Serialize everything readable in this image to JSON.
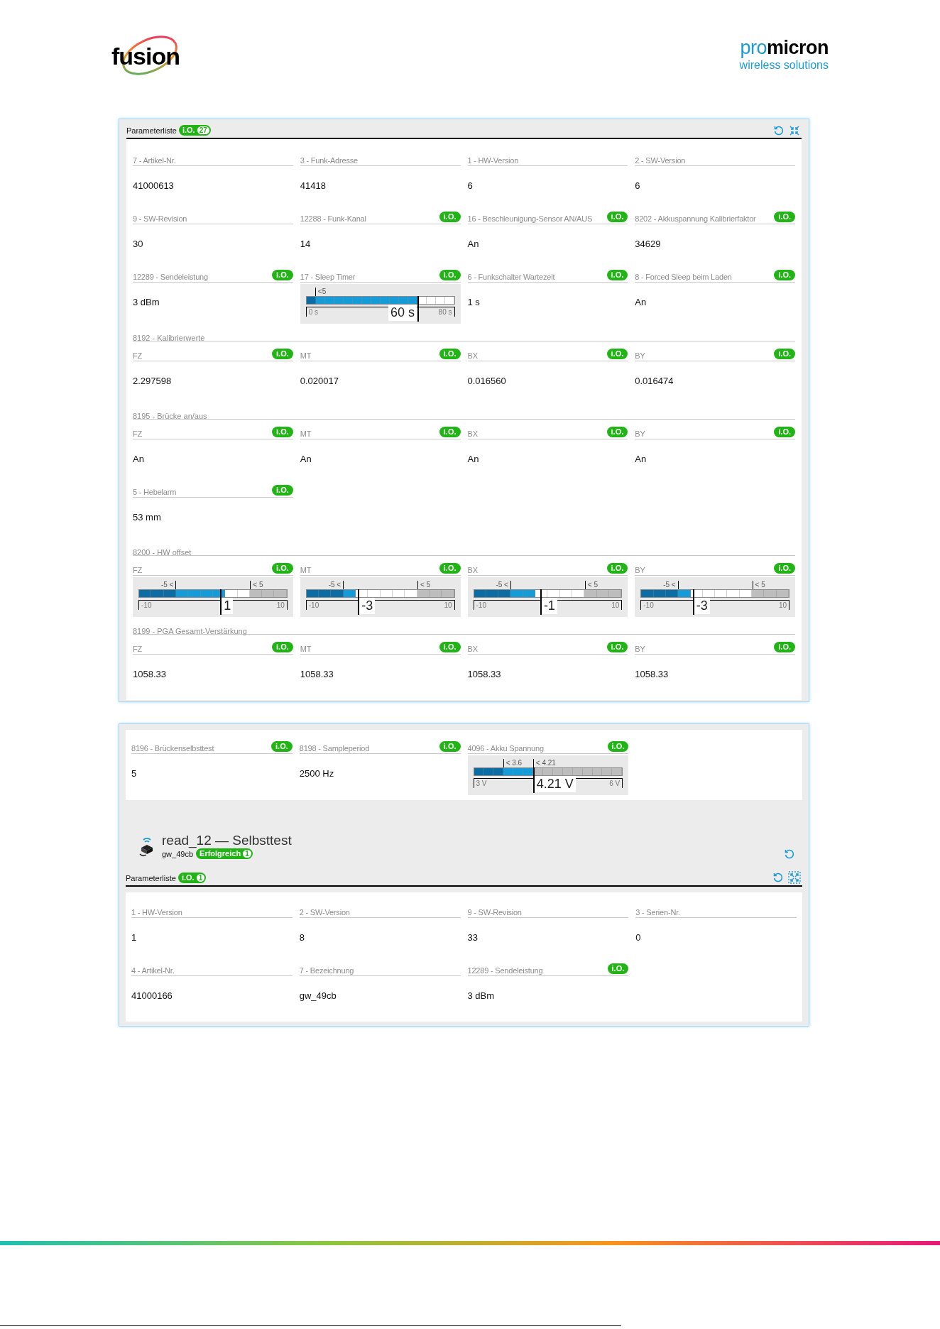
{
  "header": {
    "left_logo": "fusion",
    "right_logo": {
      "part_1": "pro",
      "part_2": "micron"
    },
    "tagline": "wireless solutions"
  },
  "panel_1": {
    "title": "Parameterliste",
    "badge": {
      "text": "i.O.",
      "count": "27"
    },
    "items": [
      {
        "kind": "field",
        "label": "7 - Artikel-Nr.",
        "value": "41000613"
      },
      {
        "kind": "field",
        "label": "3 - Funk-Adresse",
        "value": "41418"
      },
      {
        "kind": "field",
        "label": "1 - HW-Version",
        "value": "6"
      },
      {
        "kind": "field",
        "label": "2 - SW-Version",
        "value": "6"
      },
      {
        "kind": "field",
        "label": "9 - SW-Revision",
        "value": "30"
      },
      {
        "kind": "field",
        "label": "12288 - Funk-Kanal",
        "badge": "i.O.",
        "value": "14"
      },
      {
        "kind": "field",
        "label": "16 - Beschleunigung-Sensor AN/AUS",
        "badge": "i.O.",
        "value": "An"
      },
      {
        "kind": "field",
        "label": "8202 - Akkuspannung Kalibrierfaktor",
        "badge": "i.O.",
        "value": "34629"
      },
      {
        "kind": "field",
        "label": "12289 - Sendeleistung",
        "badge": "i.O.",
        "value": "3 dBm"
      },
      {
        "kind": "gauge",
        "label": "17 - Sleep Timer",
        "badge": "i.O.",
        "min": "0 s",
        "max": "80 s",
        "value": "60 s",
        "level": 0.75,
        "cells": [
          {
            "kind": "low"
          },
          {
            "kind": "mid",
            "mark": {
              "text": "<5",
              "before": false
            }
          },
          {
            "kind": "mid"
          },
          {
            "kind": "mid"
          },
          {
            "kind": "mid"
          },
          {
            "kind": "mid"
          },
          {
            "kind": "mid"
          },
          {
            "kind": "mid"
          },
          {
            "kind": "mid"
          },
          {
            "kind": "mid"
          },
          {
            "kind": "mid"
          },
          {
            "kind": "mid"
          },
          {
            "kind": "mid"
          },
          {
            "kind": "mid"
          },
          {
            "kind": "mid"
          },
          {
            "kind": "mid"
          }
        ]
      },
      {
        "kind": "field",
        "label": "6 - Funkschalter Wartezeit",
        "badge": "i.O.",
        "value": "1 s"
      },
      {
        "kind": "field",
        "label": "8 - Forced Sleep beim Laden",
        "badge": "i.O.",
        "value": "An"
      },
      {
        "kind": "section",
        "label": "8192 - Kalibrierwerte"
      },
      {
        "kind": "field",
        "label": "FZ",
        "badge": "i.O.",
        "value": "2.297598"
      },
      {
        "kind": "field",
        "label": "MT",
        "badge": "i.O.",
        "value": "0.020017"
      },
      {
        "kind": "field",
        "label": "BX",
        "badge": "i.O.",
        "value": "0.016560"
      },
      {
        "kind": "field",
        "label": "BY",
        "badge": "i.O.",
        "value": "0.016474"
      },
      {
        "kind": "section",
        "label": "8195 - Brücke an/aus"
      },
      {
        "kind": "field",
        "label": "FZ",
        "badge": "i.O.",
        "value": "An"
      },
      {
        "kind": "field",
        "label": "MT",
        "badge": "i.O.",
        "value": "An"
      },
      {
        "kind": "field",
        "label": "BX",
        "badge": "i.O.",
        "value": "An"
      },
      {
        "kind": "field",
        "label": "BY",
        "badge": "i.O.",
        "value": "An"
      },
      {
        "kind": "field",
        "label": "5 - Hebelarm",
        "badge": "i.O.",
        "value": "53 mm"
      },
      {
        "kind": "section",
        "label": "8200 - HW offset"
      },
      {
        "kind": "gauge",
        "label": "FZ",
        "badge": "i.O.",
        "min": "-10",
        "max": "10",
        "value": "1",
        "level": 0.55,
        "cells": [
          {
            "kind": "low"
          },
          {
            "kind": "low"
          },
          {
            "kind": "low"
          },
          {
            "kind": "mid",
            "mark": {
              "text": "-5 <",
              "before": true
            }
          },
          {
            "kind": "mid"
          },
          {
            "kind": "mid"
          },
          {
            "kind": "mid"
          },
          {
            "kind": "mid"
          },
          {
            "kind": "mid"
          },
          {
            "kind": "high",
            "mark": {
              "text": "< 5",
              "before": false
            }
          },
          {
            "kind": "high"
          },
          {
            "kind": "high"
          }
        ]
      },
      {
        "kind": "gauge",
        "label": "MT",
        "badge": "i.O.",
        "min": "-10",
        "max": "10",
        "value": "-3",
        "level": 0.35,
        "cells": [
          {
            "kind": "low"
          },
          {
            "kind": "low"
          },
          {
            "kind": "low"
          },
          {
            "kind": "mid",
            "mark": {
              "text": "-5 <",
              "before": true
            }
          },
          {
            "kind": "mid"
          },
          {
            "kind": "mid"
          },
          {
            "kind": "mid"
          },
          {
            "kind": "mid"
          },
          {
            "kind": "mid"
          },
          {
            "kind": "high",
            "mark": {
              "text": "< 5",
              "before": false
            }
          },
          {
            "kind": "high"
          },
          {
            "kind": "high"
          }
        ]
      },
      {
        "kind": "gauge",
        "label": "BX",
        "badge": "i.O.",
        "min": "-10",
        "max": "10",
        "value": "-1",
        "level": 0.45,
        "cells": [
          {
            "kind": "low"
          },
          {
            "kind": "low"
          },
          {
            "kind": "low"
          },
          {
            "kind": "mid",
            "mark": {
              "text": "-5 <",
              "before": true
            }
          },
          {
            "kind": "mid"
          },
          {
            "kind": "mid"
          },
          {
            "kind": "mid"
          },
          {
            "kind": "mid"
          },
          {
            "kind": "mid"
          },
          {
            "kind": "high",
            "mark": {
              "text": "< 5",
              "before": false
            }
          },
          {
            "kind": "high"
          },
          {
            "kind": "high"
          }
        ]
      },
      {
        "kind": "gauge",
        "label": "BY",
        "badge": "i.O.",
        "min": "-10",
        "max": "10",
        "value": "-3",
        "level": 0.35,
        "cells": [
          {
            "kind": "low"
          },
          {
            "kind": "low"
          },
          {
            "kind": "low"
          },
          {
            "kind": "mid",
            "mark": {
              "text": "-5 <",
              "before": true
            }
          },
          {
            "kind": "mid"
          },
          {
            "kind": "mid"
          },
          {
            "kind": "mid"
          },
          {
            "kind": "mid"
          },
          {
            "kind": "mid"
          },
          {
            "kind": "high",
            "mark": {
              "text": "< 5",
              "before": false
            }
          },
          {
            "kind": "high"
          },
          {
            "kind": "high"
          }
        ]
      },
      {
        "kind": "section",
        "label": "8199 - PGA Gesamt-Verstärkung"
      },
      {
        "kind": "field",
        "label": "FZ",
        "badge": "i.O.",
        "value": "1058.33"
      },
      {
        "kind": "field",
        "label": "MT",
        "badge": "i.O.",
        "value": "1058.33"
      },
      {
        "kind": "field",
        "label": "BX",
        "badge": "i.O.",
        "value": "1058.33"
      },
      {
        "kind": "field",
        "label": "BY",
        "badge": "i.O.",
        "value": "1058.33"
      }
    ]
  },
  "panel_2": {
    "items": [
      {
        "kind": "field",
        "label": "8196 - Brückenselbsttest",
        "badge": "i.O.",
        "value": "5"
      },
      {
        "kind": "field",
        "label": "8198 - Sampleperiod",
        "badge": "i.O.",
        "value": "2500 Hz"
      },
      {
        "kind": "gauge",
        "label": "4096 - Akku Spannung",
        "badge": "i.O.",
        "min": "3 V",
        "max": "6 V",
        "value": "4.21 V",
        "level": 0.4,
        "cells": [
          {
            "kind": "low"
          },
          {
            "kind": "low"
          },
          {
            "kind": "low"
          },
          {
            "kind": "mid",
            "mark": {
              "text": "< 3.6",
              "before": false
            }
          },
          {
            "kind": "mid"
          },
          {
            "kind": "mid"
          },
          {
            "kind": "high",
            "mark": {
              "text": "< 4.21",
              "before": false
            }
          },
          {
            "kind": "high"
          },
          {
            "kind": "high"
          },
          {
            "kind": "high"
          },
          {
            "kind": "high"
          },
          {
            "kind": "high"
          },
          {
            "kind": "high"
          },
          {
            "kind": "high"
          },
          {
            "kind": "high"
          }
        ]
      }
    ],
    "device": {
      "title": "read_12 — Selbsttest",
      "subtitle": "gw_49cb",
      "status": {
        "text": "Erfolgreich",
        "count": "1"
      }
    },
    "list": {
      "title": "Parameterliste",
      "badge": {
        "text": "i.O.",
        "count": "1"
      },
      "items": [
        {
          "kind": "field",
          "label": "1 - HW-Version",
          "value": "1"
        },
        {
          "kind": "field",
          "label": "2 - SW-Version",
          "value": "8"
        },
        {
          "kind": "field",
          "label": "9 - SW-Revision",
          "value": "33"
        },
        {
          "kind": "field",
          "label": "3 - Serien-Nr.",
          "value": "0"
        },
        {
          "kind": "field",
          "label": "4 - Artikel-Nr.",
          "value": "41000166"
        },
        {
          "kind": "field",
          "label": "7 - Bezeichnung",
          "value": "gw_49cb"
        },
        {
          "kind": "field",
          "label": "12289 - Sendeleistung",
          "badge": "i.O.",
          "value": "3 dBm"
        }
      ]
    }
  }
}
